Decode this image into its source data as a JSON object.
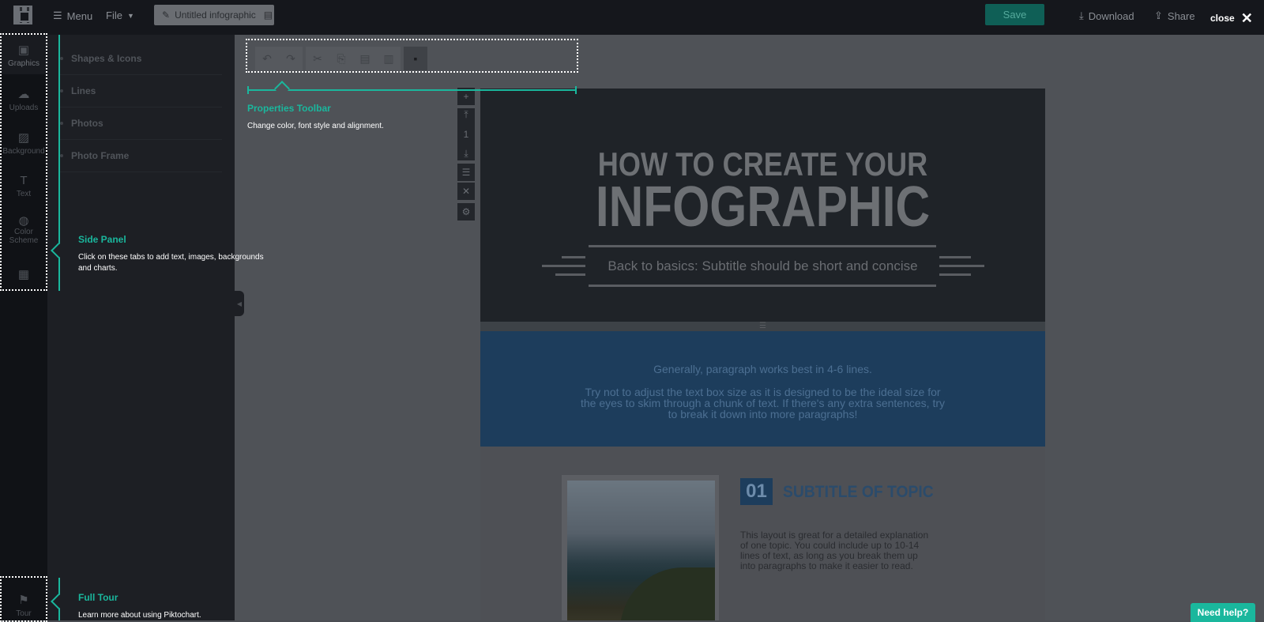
{
  "topbar": {
    "menu_label": "Menu",
    "file_label": "File",
    "doc_title": "Untitled infographic",
    "save_label": "Save",
    "download_label": "Download",
    "share_label": "Share",
    "close_label": "close"
  },
  "iconbar": {
    "items": [
      {
        "label": "Graphics",
        "icon": "image-icon"
      },
      {
        "label": "Uploads",
        "icon": "cloud-upload-icon"
      },
      {
        "label": "Background",
        "icon": "background-icon"
      },
      {
        "label": "Text",
        "icon": "text-icon"
      },
      {
        "label": "Color Scheme",
        "icon": "palette-icon"
      },
      {
        "label": "",
        "icon": "toolbox-icon"
      },
      {
        "label": "Tour",
        "icon": "signpost-icon"
      }
    ]
  },
  "sidepanel": {
    "items": [
      "Shapes & Icons",
      "Lines",
      "Photos",
      "Photo Frame"
    ]
  },
  "tour": {
    "toolbar_title": "Properties Toolbar",
    "toolbar_text": "Change color, font style and alignment.",
    "sidepanel_title": "Side Panel",
    "sidepanel_text_1": "Click on these tabs to add text, images, backgrounds",
    "sidepanel_text_2": "and charts.",
    "fulltour_title": "Full Tour",
    "fulltour_text": "Learn more about using Piktochart."
  },
  "infographic": {
    "title_line1": "HOW TO CREATE YOUR",
    "title_line2": "INFOGRAPHIC",
    "subtitle": "Back to basics: Subtitle should be short and concise",
    "para1": "Generally, paragraph works best in 4-6 lines.",
    "para2_l1": "Try not to adjust the text box size as it is designed to be the ideal size for",
    "para2_l2": "the eyes to skim through a chunk of text. If there's any extra sentences, try",
    "para2_l3": "to break it down into more paragraphs!",
    "topic_number": "01",
    "topic_title": "SUBTITLE OF TOPIC",
    "topic_body_l1": "This layout is great for a detailed explanation",
    "topic_body_l2": "of one topic. You could include up to 10-14",
    "topic_body_l3": "lines of text, as long as you break them up",
    "topic_body_l4": "into paragraphs to make it easier to read."
  },
  "help_label": "Need help?",
  "colors": {
    "accent": "#1ab79d",
    "topbar": "#15171c",
    "sidepanel": "#1d1f24"
  }
}
